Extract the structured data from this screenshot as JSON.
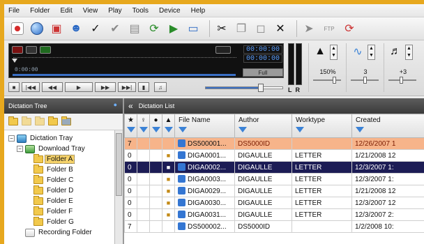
{
  "menu": [
    "File",
    "Folder",
    "Edit",
    "View",
    "Play",
    "Tools",
    "Device",
    "Help"
  ],
  "toolbar": {
    "icons": [
      "record-icon",
      "globe-icon",
      "tray-icon",
      "user-icon",
      "check-icon",
      "approve-icon",
      "book-icon",
      "refresh-icon",
      "send-icon",
      "monitor-icon",
      "cut-icon",
      "copy-icon",
      "paste-icon",
      "delete-icon",
      "send-mail-icon",
      "ftp-icon",
      "sync-icon"
    ],
    "ftp_label": "FTP"
  },
  "player": {
    "time_current": "00:00:00",
    "time_total": "00:00:00",
    "position": "0:00:00",
    "mode": "Full",
    "vu_label": "LR",
    "speed_value": "150%",
    "noise_value": "3",
    "tone_value": "+3",
    "volume_fraction": 0.72
  },
  "tree": {
    "header": "Dictation Tree",
    "items": [
      {
        "label": "Dictation Tray",
        "depth": 0,
        "icon": "tray-icon",
        "expanded": true
      },
      {
        "label": "Download Tray",
        "depth": 1,
        "icon": "download-tray-icon",
        "expanded": true
      },
      {
        "label": "Folder A",
        "depth": 2,
        "icon": "folder-icon",
        "selected": true
      },
      {
        "label": "Folder B",
        "depth": 2,
        "icon": "folder-icon"
      },
      {
        "label": "Folder C",
        "depth": 2,
        "icon": "folder-icon"
      },
      {
        "label": "Folder D",
        "depth": 2,
        "icon": "folder-icon"
      },
      {
        "label": "Folder E",
        "depth": 2,
        "icon": "folder-icon"
      },
      {
        "label": "Folder F",
        "depth": 2,
        "icon": "folder-icon"
      },
      {
        "label": "Folder G",
        "depth": 2,
        "icon": "folder-icon"
      },
      {
        "label": "Recording Folder",
        "depth": 1,
        "icon": "recording-folder-icon"
      }
    ]
  },
  "list": {
    "header": "Dictation List",
    "columns": [
      "★",
      "♀",
      "●",
      "▲",
      "File Name",
      "Author",
      "Worktype",
      "Created"
    ],
    "rows": [
      {
        "priority": "7",
        "locked": false,
        "file": "DS500001...",
        "author": "DS5000ID",
        "worktype": "",
        "created": "12/26/2007 1",
        "style": "orange"
      },
      {
        "priority": "0",
        "locked": true,
        "file": "DIGA0001...",
        "author": "DIGAULLE",
        "worktype": "LETTER",
        "created": "1/21/2008 12",
        "style": ""
      },
      {
        "priority": "0",
        "locked": true,
        "file": "DIGA0002...",
        "author": "DIGAULLE",
        "worktype": "LETTER",
        "created": "12/3/2007 1:",
        "style": "selected"
      },
      {
        "priority": "0",
        "locked": true,
        "file": "DIGA0003...",
        "author": "DIGAULLE",
        "worktype": "LETTER",
        "created": "12/3/2007 1:",
        "style": ""
      },
      {
        "priority": "0",
        "locked": true,
        "file": "DIGA0029...",
        "author": "DIGAULLE",
        "worktype": "LETTER",
        "created": "1/21/2008 12",
        "style": ""
      },
      {
        "priority": "0",
        "locked": true,
        "file": "DIGA0030...",
        "author": "DIGAULLE",
        "worktype": "LETTER",
        "created": "12/3/2007 12",
        "style": ""
      },
      {
        "priority": "0",
        "locked": true,
        "file": "DIGA0031...",
        "author": "DIGAULLE",
        "worktype": "LETTER",
        "created": "12/3/2007 2:",
        "style": ""
      },
      {
        "priority": "7",
        "locked": false,
        "file": "DS500002...",
        "author": "DS5000ID",
        "worktype": "",
        "created": "1/2/2008 10:",
        "style": ""
      }
    ]
  }
}
